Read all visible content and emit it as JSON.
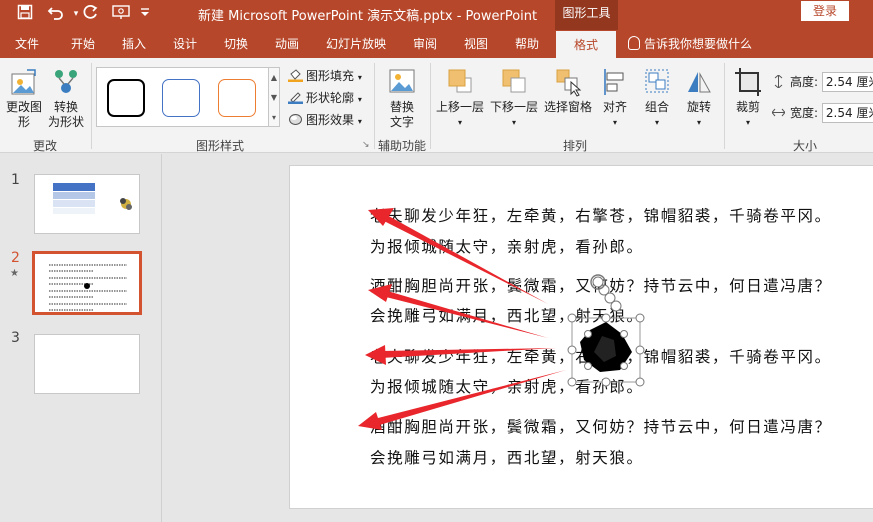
{
  "app": {
    "window_title": "新建 Microsoft PowerPoint 演示文稿.pptx  -  PowerPoint",
    "context_group": "图形工具",
    "login_label": "登录"
  },
  "quick_access": {
    "icons": [
      "save-icon",
      "undo-icon",
      "redo-icon",
      "present-icon"
    ]
  },
  "tabs": [
    {
      "label": "文件"
    },
    {
      "label": "开始"
    },
    {
      "label": "插入"
    },
    {
      "label": "设计"
    },
    {
      "label": "切换"
    },
    {
      "label": "动画"
    },
    {
      "label": "幻灯片放映"
    },
    {
      "label": "审阅"
    },
    {
      "label": "视图"
    },
    {
      "label": "帮助"
    },
    {
      "label": "格式",
      "active": true
    }
  ],
  "tell_me": "告诉我你想要做什么",
  "ribbon": {
    "change": {
      "edit_shape_line1": "更改图",
      "edit_shape_line2": "形",
      "convert_line1": "转换",
      "convert_line2": "为形状",
      "label": "更改"
    },
    "shape_styles": {
      "fill": "图形填充",
      "outline": "形状轮廓",
      "effects": "图形效果",
      "label": "图形样式",
      "swatch_colors": [
        "#000000",
        "#4472c4",
        "#ed7d31"
      ]
    },
    "accessibility": {
      "alt_text_line1": "替换",
      "alt_text_line2": "文字",
      "label": "辅助功能"
    },
    "arrange": {
      "bring_forward": "上移一层",
      "send_backward": "下移一层",
      "selection_pane": "选择窗格",
      "align": "对齐",
      "group": "组合",
      "rotate": "旋转",
      "label": "排列"
    },
    "size": {
      "crop": "裁剪",
      "height_label": "高度:",
      "height_value": "2.54 厘米",
      "width_label": "宽度:",
      "width_value": "2.54 厘米",
      "label": "大小"
    }
  },
  "slides_panel": {
    "numbers": [
      "1",
      "2",
      "3"
    ],
    "selected_index": 2
  },
  "slide": {
    "lines": [
      "老夫聊发少年狂，左牵黄，右擎苍，锦帽貂裘，千骑卷平冈。",
      "为报倾城随太守，亲射虎，看孙郎。",
      "酒酣胸胆尚开张，鬓微霜，又何妨？持节云中，何日遣冯唐？",
      "会挽雕弓如满月，西北望，射天狼。",
      "老夫聊发少年狂，左牵黄，右擎苍，锦帽貂裘，千骑卷平冈。",
      "为报倾城随太守，亲射虎，看孙郎。",
      "酒酣胸胆尚开张，鬓微霜，又何妨？持节云中，何日遣冯唐？",
      "会挽雕弓如满月，西北望，射天狼。"
    ]
  },
  "colors": {
    "accent": "#b7472a",
    "accent_dark": "#93371f",
    "annotation_arrow": "#e8262b",
    "selected_thumb_border": "#d35230"
  }
}
